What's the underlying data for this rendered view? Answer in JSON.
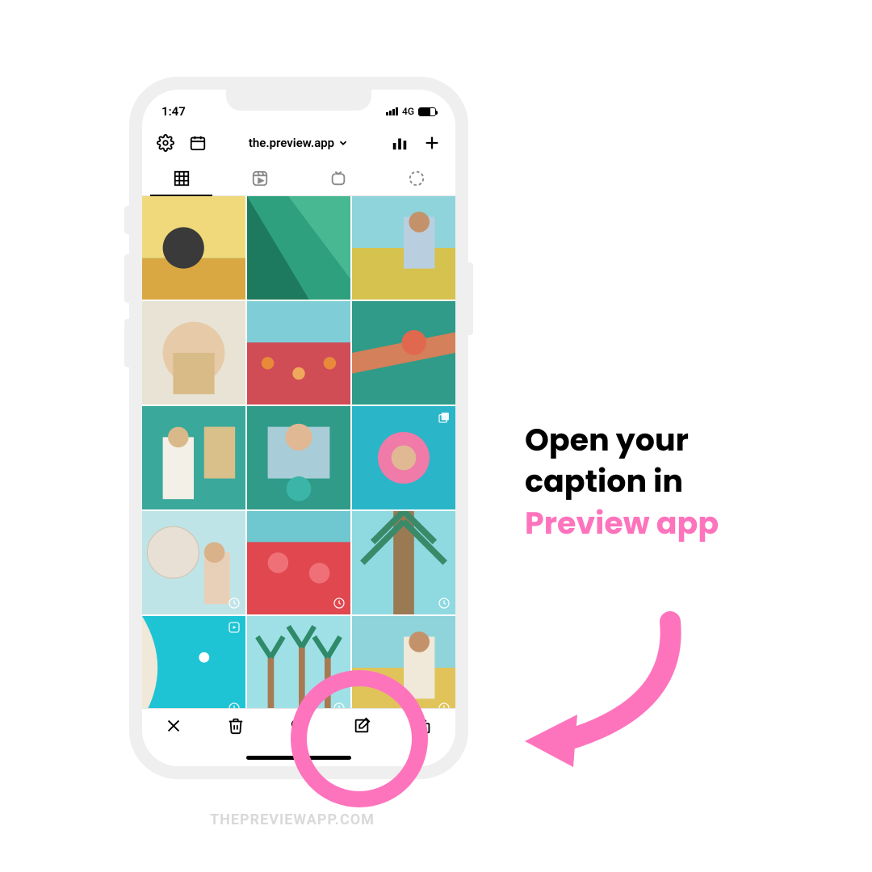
{
  "status": {
    "time": "1:47",
    "network": "4G"
  },
  "toolbar": {
    "account": "the.preview.app"
  },
  "instruction": {
    "line1": "Open your",
    "line2": "caption in",
    "line3": "Preview app"
  },
  "watermark": "THEPREVIEWAPP.COM",
  "icons": {
    "settings": "gear-icon",
    "calendar": "calendar-icon",
    "analytics": "analytics-icon",
    "add": "plus-icon",
    "grid": "grid-icon",
    "reels": "reels-icon",
    "igtv": "igtv-icon",
    "stories": "stories-icon",
    "close": "close-icon",
    "trash": "trash-icon",
    "filter": "filter-icon",
    "edit": "edit-icon",
    "export": "export-icon",
    "clock": "clock-icon",
    "carousel": "carousel-icon",
    "reelBadge": "reel-badge-icon"
  },
  "grid_cells": [
    {
      "palette": "sunflower"
    },
    {
      "palette": "leaf"
    },
    {
      "palette": "yellowfield"
    },
    {
      "palette": "soft"
    },
    {
      "palette": "flowers"
    },
    {
      "palette": "hammock"
    },
    {
      "palette": "beachchair"
    },
    {
      "palette": "coffee"
    },
    {
      "palette": "pool",
      "badge": "carousel"
    },
    {
      "palette": "ferris",
      "clock": true
    },
    {
      "palette": "redflowers",
      "clock": true
    },
    {
      "palette": "palm",
      "clock": true
    },
    {
      "palette": "ocean",
      "clock": true,
      "reel": true
    },
    {
      "palette": "palmsky",
      "clock": true
    },
    {
      "palette": "fieldgirl",
      "clock": true
    }
  ]
}
